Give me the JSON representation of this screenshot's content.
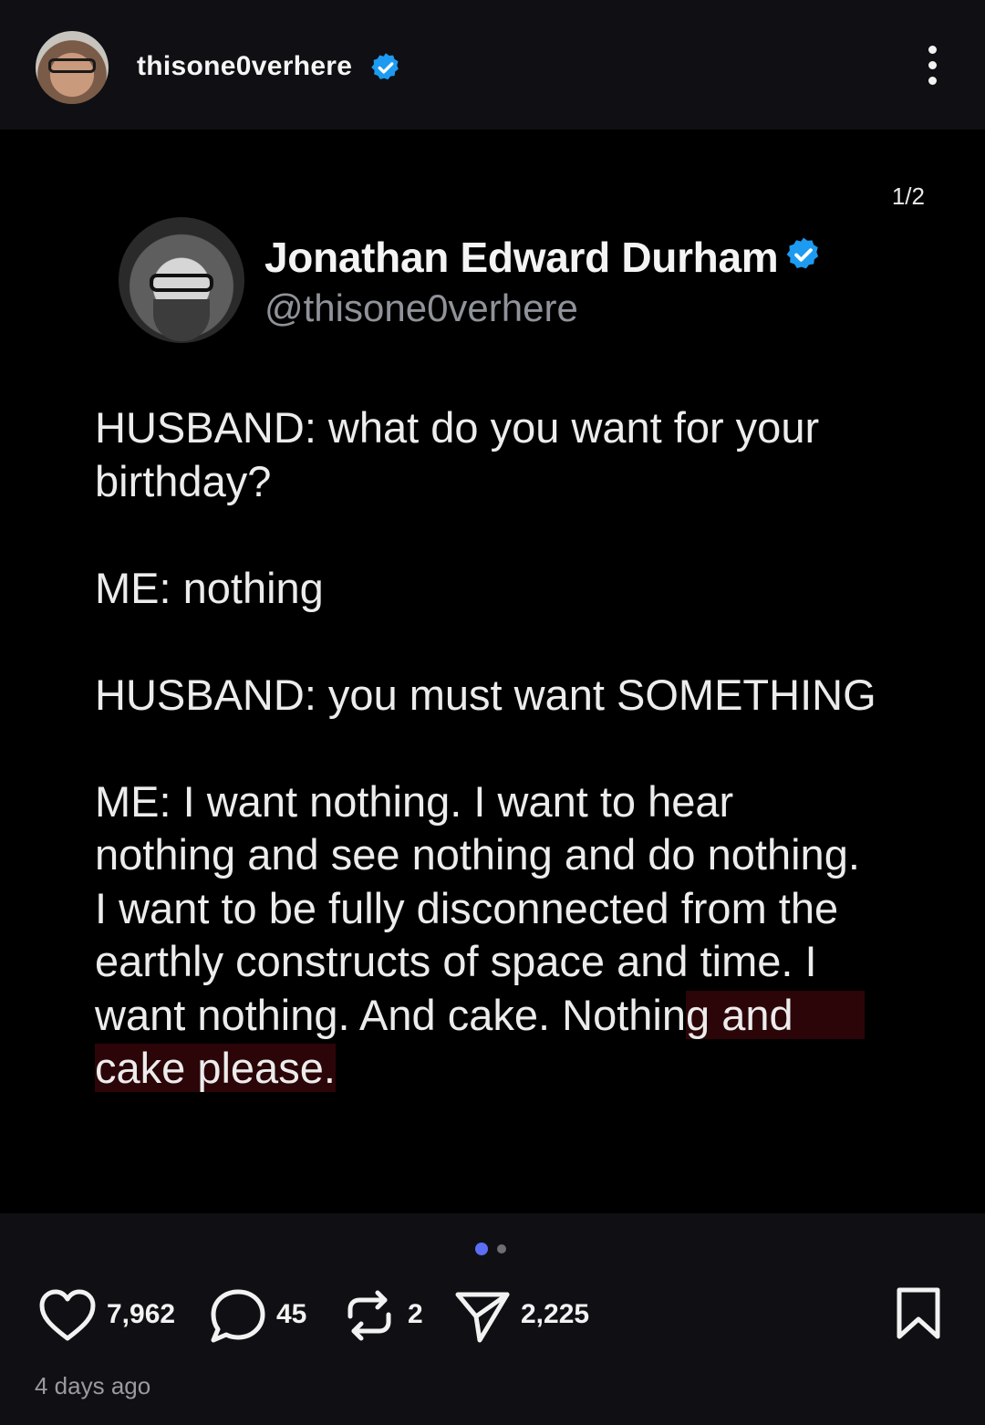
{
  "header": {
    "username": "thisone0verhere",
    "avatar": "profile-photo",
    "verified_icon": "verified-badge-icon",
    "more_icon": "more-vertical-icon"
  },
  "media": {
    "page_counter": "1/2",
    "tweet": {
      "display_name": "Jonathan Edward Durham",
      "handle": "@thisone0verhere",
      "body_before_highlight": "HUSBAND: what do you want for your\nbirthday?\n\nME: nothing\n\nHUSBAND: you must want SOMETHING\n\nME: I want nothing. I want to hear\nnothing and see nothing and do nothing.\nI want to be fully disconnected from the\nearthly constructs of space and time. I\nwant nothing. And cake. Nothin",
      "body_highlighted_1": "g and      ",
      "body_line_break": "\n",
      "body_highlighted_2": "cake please."
    },
    "carousel": {
      "current": 1,
      "total": 2
    }
  },
  "actions": {
    "likes": "7,962",
    "comments": "45",
    "reposts": "2",
    "shares": "2,225",
    "like_icon": "heart-icon",
    "comment_icon": "comment-icon",
    "repost_icon": "repost-icon",
    "share_icon": "send-icon",
    "bookmark_icon": "bookmark-icon"
  },
  "timestamp": "4 days ago",
  "colors": {
    "background": "#101014",
    "media_background": "#000000",
    "verified": "#1d9bf0",
    "carousel_active": "#5b6ef5",
    "highlight": "#2c0508"
  }
}
